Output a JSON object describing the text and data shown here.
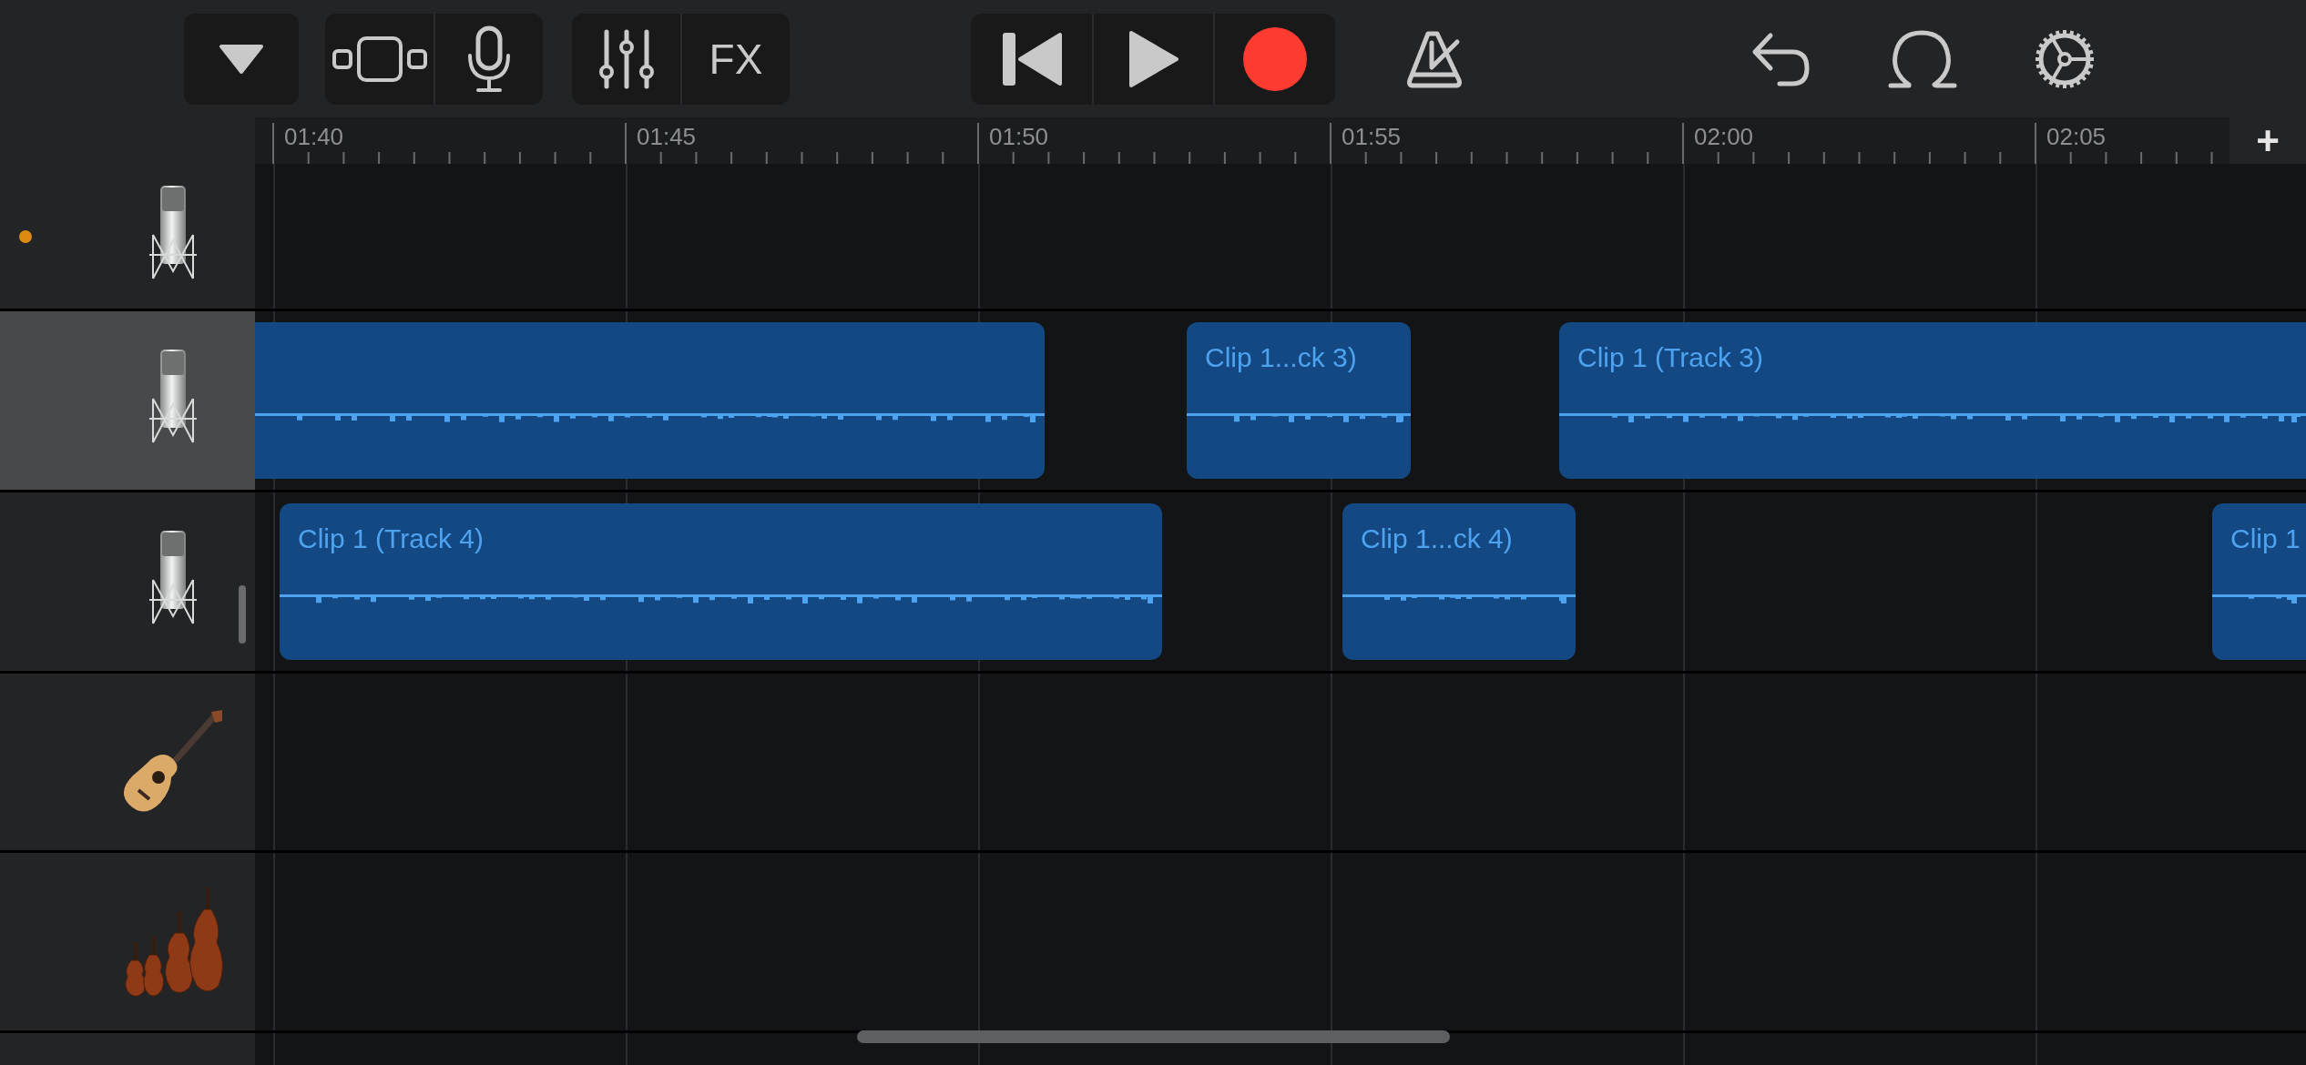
{
  "toolbar": {
    "groups": [
      {
        "framed": true,
        "buttons": [
          {
            "kind": "dropdown"
          }
        ]
      },
      {
        "framed": true,
        "buttons": [
          {
            "kind": "browser"
          },
          {
            "kind": "microphone"
          }
        ]
      },
      {
        "framed": true,
        "buttons": [
          {
            "kind": "mixer"
          },
          {
            "kind": "fx",
            "label": "FX"
          }
        ]
      },
      {
        "framed": true,
        "buttons": [
          {
            "kind": "rewind"
          },
          {
            "kind": "play"
          },
          {
            "kind": "record"
          }
        ]
      },
      {
        "framed": false,
        "buttons": [
          {
            "kind": "metronome"
          }
        ]
      },
      {
        "framed": false,
        "buttons": [
          {
            "kind": "undo"
          }
        ]
      },
      {
        "framed": false,
        "buttons": [
          {
            "kind": "loop"
          }
        ]
      },
      {
        "framed": false,
        "buttons": [
          {
            "kind": "settings"
          }
        ]
      }
    ]
  },
  "ruler": {
    "labels": [
      "01:40",
      "01:45",
      "01:50",
      "01:55",
      "02:00",
      "02:05"
    ],
    "add_button": "+"
  },
  "tracks": [
    {
      "kind": "microphone",
      "selected": false,
      "status_dot": true
    },
    {
      "kind": "microphone",
      "selected": true,
      "status_dot": false,
      "clips": [
        {
          "kind": "audio"
        },
        {
          "kind": "audio",
          "label": "Clip 1...ck 3)"
        },
        {
          "kind": "audio",
          "label": "Clip 1 (Track 3)"
        }
      ]
    },
    {
      "kind": "microphone",
      "selected": false,
      "status_dot": false,
      "clips": [
        {
          "kind": "audio",
          "label": "Clip 1 (Track 4)"
        },
        {
          "kind": "audio",
          "label": "Clip 1...ck 4)"
        },
        {
          "kind": "audio",
          "label": "Clip 1"
        }
      ]
    },
    {
      "kind": "guitar",
      "selected": false,
      "status_dot": false
    },
    {
      "kind": "strings",
      "selected": false,
      "status_dot": false
    }
  ]
}
